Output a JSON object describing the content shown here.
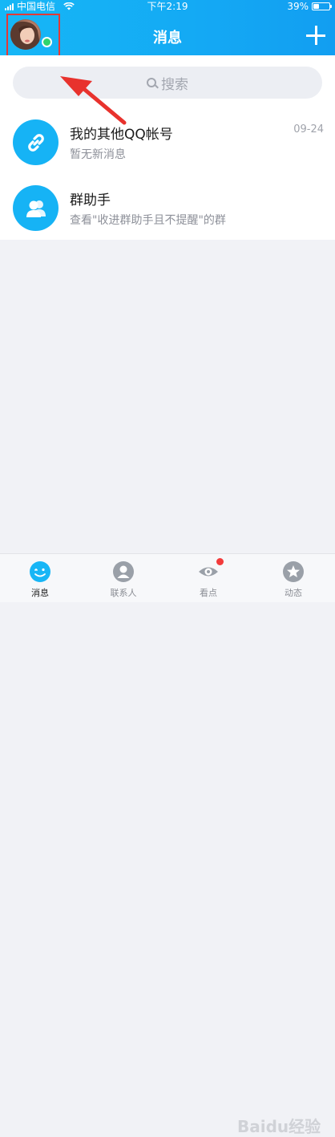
{
  "status_bar": {
    "carrier": "中国电信",
    "time": "下午2:19",
    "battery": "39%",
    "battery_level": 0.39
  },
  "header": {
    "title": "消息",
    "add_icon": "plus-icon"
  },
  "search": {
    "placeholder": "搜索"
  },
  "conversations": [
    {
      "title": "我的其他QQ帐号",
      "subtitle": "暂无新消息",
      "time": "09-24",
      "icon": "link-icon"
    },
    {
      "title": "群助手",
      "subtitle": "查看\"收进群助手且不提醒\"的群",
      "time": "",
      "icon": "group-icon"
    }
  ],
  "tabs": [
    {
      "label": "消息",
      "icon": "message-icon",
      "active": true
    },
    {
      "label": "联系人",
      "icon": "contacts-icon",
      "active": false
    },
    {
      "label": "看点",
      "icon": "eye-icon",
      "active": false,
      "badge": true
    },
    {
      "label": "动态",
      "icon": "star-icon",
      "active": false
    }
  ],
  "watermark": "Baidu经验",
  "colors": {
    "header": "#14a9f4",
    "accent": "#16b3f5",
    "highlight_box": "#e53935",
    "online": "#2fd46d"
  }
}
